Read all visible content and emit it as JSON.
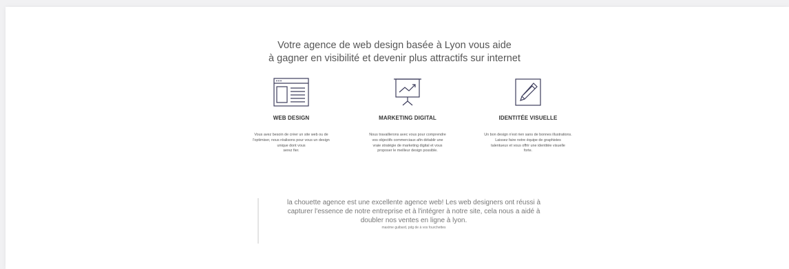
{
  "headline": {
    "line1": "Votre agence de web design basée à Lyon vous aide",
    "line2": "à gagner en visibilité et devenir plus attractifs sur internet"
  },
  "services": [
    {
      "icon": "browser-window-icon",
      "title": "WEB DESIGN",
      "lines": [
        "Vous avez besoin de créer un site web ou de",
        "l'optimiser, nous réalisons pour vous un design",
        "unique dont vous",
        "serez fier."
      ]
    },
    {
      "icon": "presentation-chart-icon",
      "title": "MARKETING DIGITAL",
      "lines": [
        "Nous travaillerons avec vous pour comprendre",
        "vos objectifs commerciaux afin détablir une",
        "vraie stratégie de marketing digital et vous",
        "proposer le meilleur design possible."
      ]
    },
    {
      "icon": "pencil-icon",
      "title": "IDENTITÉE VISUELLE",
      "lines": [
        "Un bon design n'est rien sans de bonnes illustrations.",
        "Laissez faire notre équipe de graphistes",
        "talentueux et vous offrir une identitée visuelle",
        "forte."
      ]
    }
  ],
  "testimonial": {
    "line1": "la chouette agence est une excellente agence web! Les web designers ont réussi à",
    "line2": "capturer l'essence de notre entreprise et à l'intégrer à notre site, cela nous a aidé à",
    "line3": "doubler nos ventes en ligne à lyon.",
    "author": "maxime guibard, pdg de à vos fourchettes"
  }
}
